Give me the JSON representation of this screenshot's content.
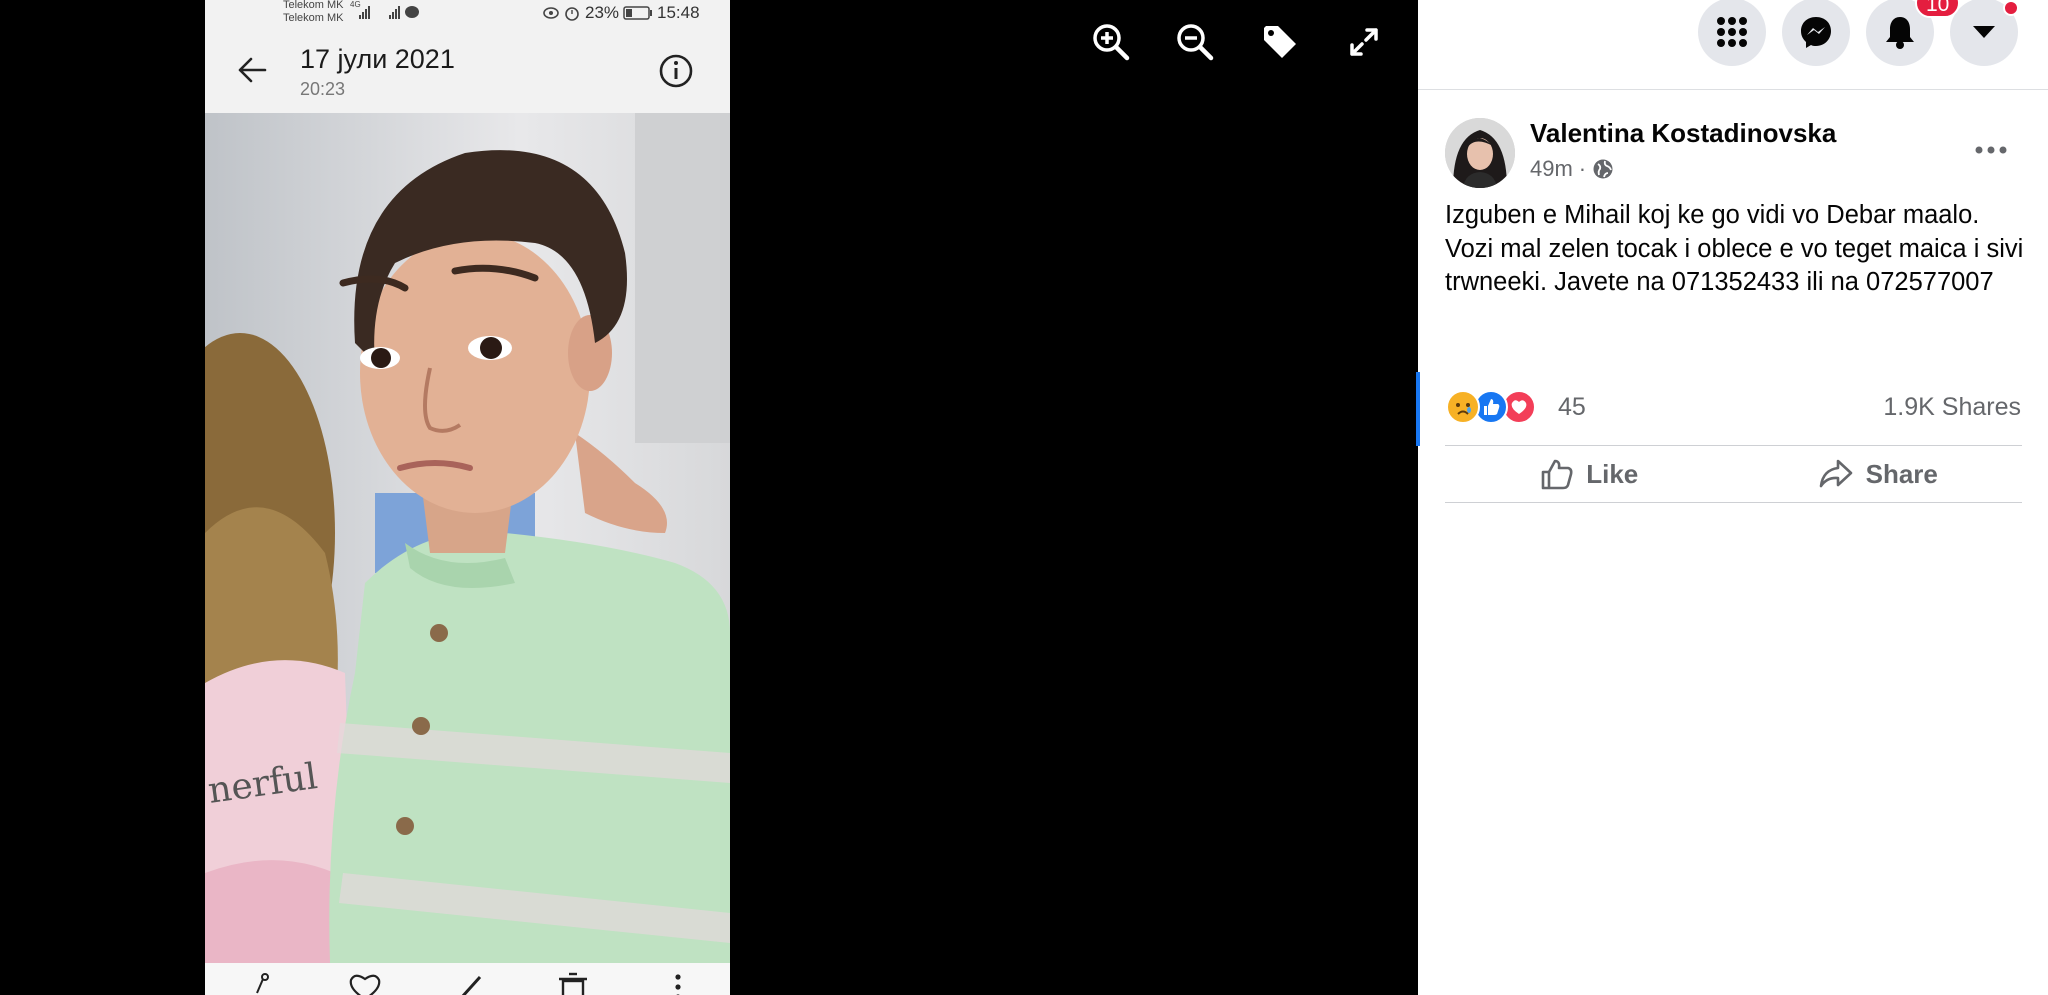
{
  "viewer": {
    "tools": [
      {
        "icon": "zoom-in-icon"
      },
      {
        "icon": "zoom-out-icon"
      },
      {
        "icon": "tag-icon"
      },
      {
        "icon": "fullscreen-icon"
      }
    ]
  },
  "phone": {
    "status": {
      "carrier1": "Telekom MK",
      "carrier2": "Telekom MK",
      "network": "4G",
      "battery": "23%",
      "time": "15:48"
    },
    "header": {
      "title": "17 јули 2021",
      "time": "20:23"
    },
    "photo": {
      "shirt_text": "nerful"
    },
    "bottom_icons": [
      "share-icon",
      "heart-icon",
      "edit-icon",
      "delete-icon",
      "more-icon"
    ]
  },
  "nav": {
    "notification_count": "10",
    "colors": {
      "badge": "#e41e3f",
      "accent": "#1877f2"
    }
  },
  "post": {
    "author": "Valentina Kostadinovska",
    "time": "49m",
    "separator": "·",
    "text": "Izguben e Mihail koj ke go vidi vo Debar maalo. Vozi mal zelen tocak i oblece e vo teget maica i sivi trwneeki. Javete na 071352433 ili na 072577007",
    "reactions": [
      "sad",
      "like",
      "love"
    ],
    "reaction_count": "45",
    "shares": "1.9K Shares",
    "actions": {
      "like": "Like",
      "share": "Share"
    }
  }
}
